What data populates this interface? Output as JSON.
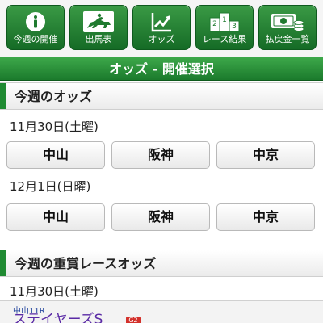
{
  "nav": {
    "items": [
      {
        "label": "今週の開催",
        "icon": "info-icon"
      },
      {
        "label": "出馬表",
        "icon": "horse-racing-icon"
      },
      {
        "label": "オッズ",
        "icon": "trend-chart-icon"
      },
      {
        "label": "レース結果",
        "icon": "podium-icon"
      },
      {
        "label": "払戻金一覧",
        "icon": "money-coins-icon"
      }
    ]
  },
  "page_title": "オッズ - 開催選択",
  "weekly_odds": {
    "heading": "今週のオッズ",
    "days": [
      {
        "date": "11月30日(土曜)",
        "venues": [
          "中山",
          "阪神",
          "中京"
        ]
      },
      {
        "date": "12月1日(日曜)",
        "venues": [
          "中山",
          "阪神",
          "中京"
        ]
      }
    ]
  },
  "graded_odds": {
    "heading": "今週の重賞レースオッズ",
    "date": "11月30日(土曜)",
    "race": {
      "number": "中山11R",
      "name": "ステイヤーズS",
      "grade": "G2"
    }
  },
  "colors": {
    "brand_green": "#1b7a2c",
    "race_name": "#5a2aa5",
    "race_number": "#1a3e9a"
  }
}
